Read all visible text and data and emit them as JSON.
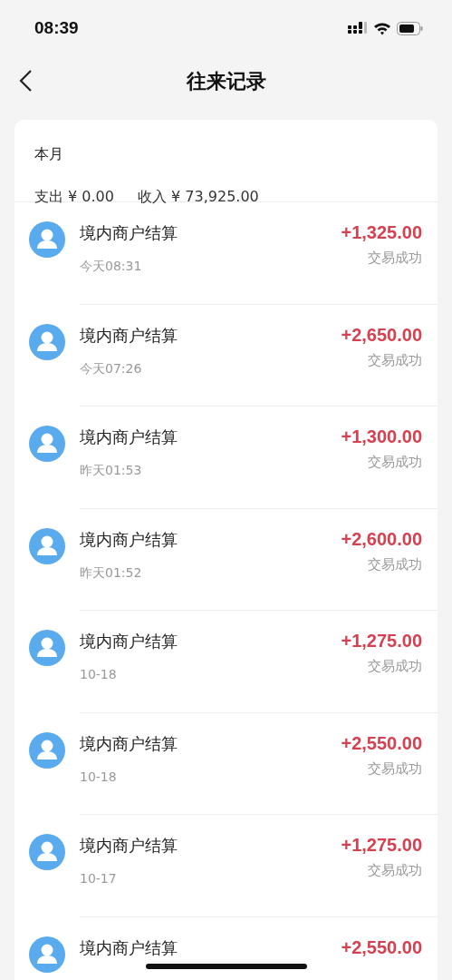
{
  "status_bar": {
    "time": "08:39"
  },
  "header": {
    "title": "往来记录"
  },
  "summary": {
    "period": "本月",
    "expense": "支出 ¥ 0.00",
    "income": "收入 ¥ 73,925.00"
  },
  "records": [
    {
      "name": "境内商户结算",
      "time": "今天08:31",
      "amount": "+1,325.00",
      "status": "交易成功"
    },
    {
      "name": "境内商户结算",
      "time": "今天07:26",
      "amount": "+2,650.00",
      "status": "交易成功"
    },
    {
      "name": "境内商户结算",
      "time": "昨天01:53",
      "amount": "+1,300.00",
      "status": "交易成功"
    },
    {
      "name": "境内商户结算",
      "time": "昨天01:52",
      "amount": "+2,600.00",
      "status": "交易成功"
    },
    {
      "name": "境内商户结算",
      "time": "10-18",
      "amount": "+1,275.00",
      "status": "交易成功"
    },
    {
      "name": "境内商户结算",
      "time": "10-18",
      "amount": "+2,550.00",
      "status": "交易成功"
    },
    {
      "name": "境内商户结算",
      "time": "10-17",
      "amount": "+1,275.00",
      "status": "交易成功"
    },
    {
      "name": "境内商户结算",
      "amount": "+2,550.00"
    }
  ]
}
